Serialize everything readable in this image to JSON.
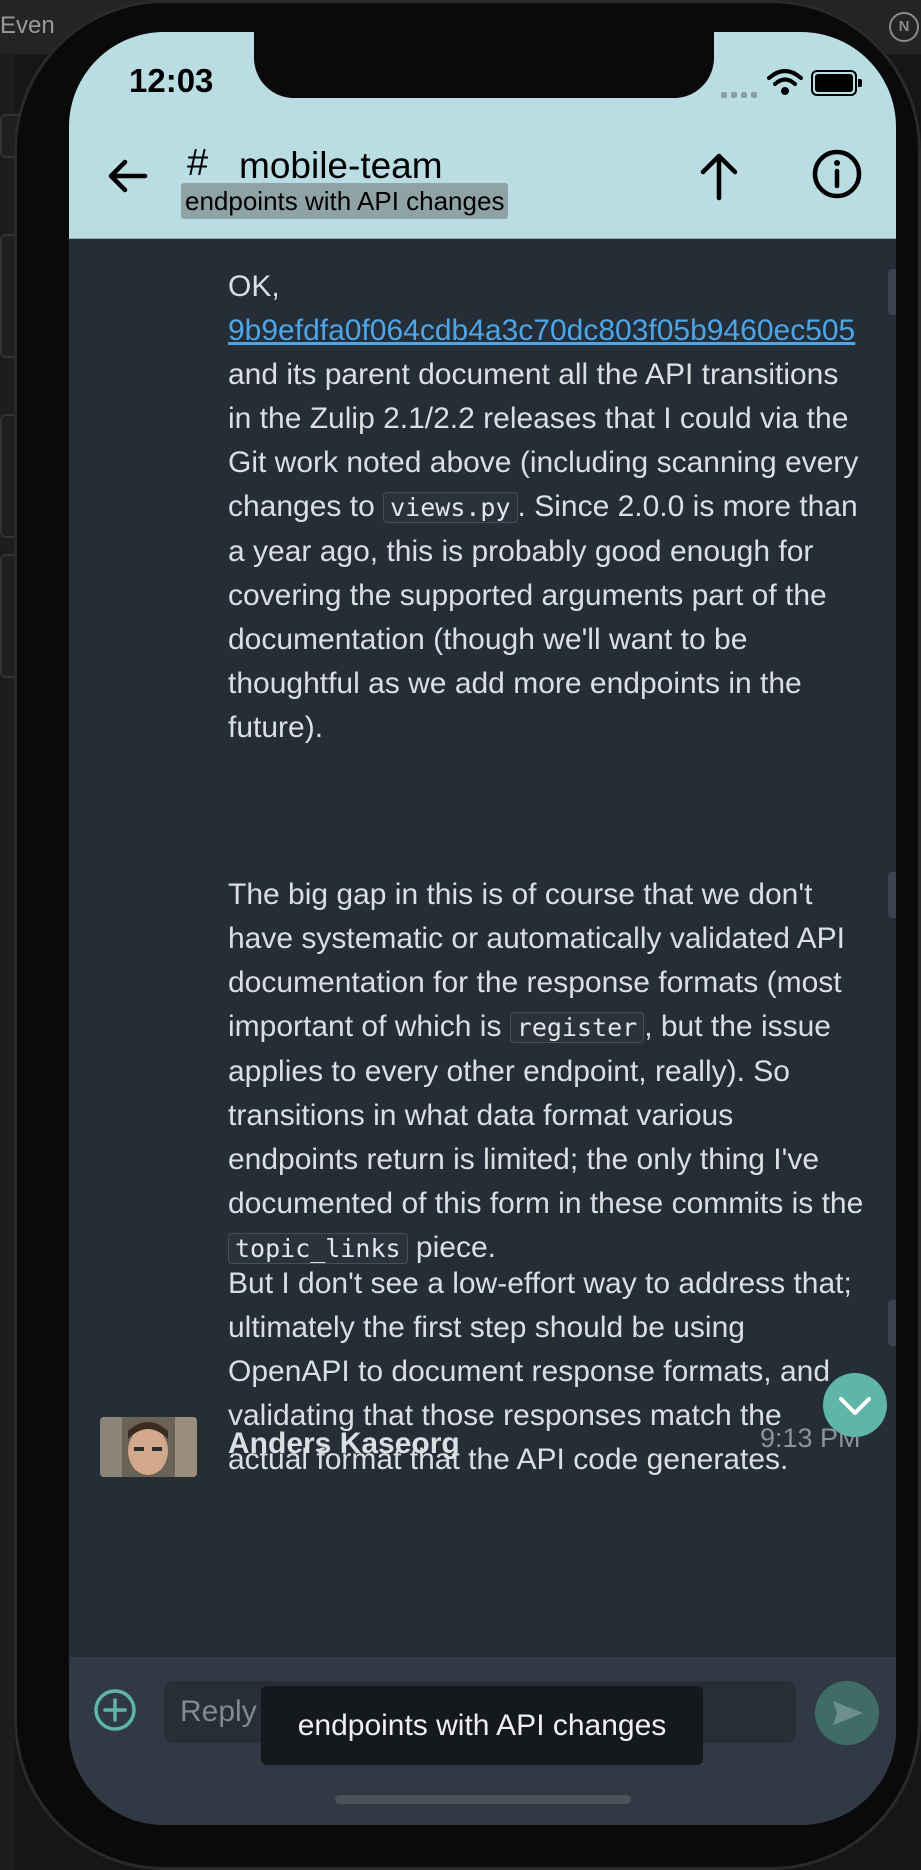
{
  "desktop": {
    "window_label": "Even",
    "right_icon": "N"
  },
  "status_bar": {
    "time": "12:03"
  },
  "header": {
    "back_icon": "arrow-left-icon",
    "stream_icon": "#",
    "stream_name": "mobile-team",
    "topic": "endpoints with API changes",
    "up_icon": "arrow-up-icon",
    "info_icon": "info-icon",
    "background": "#b9dde3"
  },
  "messages": {
    "para1": {
      "lead": "OK,",
      "link": "9b9efdfa0f064cdb4a3c70dc803f05b9460ec505",
      "text1": " and its parent document all the API transitions in the Zulip 2.1/2.2 releases that I could via the Git work noted above (including scanning every changes to ",
      "code1": "views.py",
      "text2": ". Since 2.0.0 is more than a year ago, this is probably good enough for covering the supported arguments part of the documentation (though we'll want to be thoughtful as we add more endpoints in the future)."
    },
    "para2": {
      "text1": "The big gap in this is of course that we don't have systematic or automatically validated API documentation for the response formats (most important of which is ",
      "code1": "register",
      "text2": ", but the issue applies to every other endpoint, really). So transitions in what data format various endpoints return is limited; the only thing I've documented of this form in these commits is the ",
      "code2": "topic_links",
      "text3": " piece."
    },
    "para3": {
      "text": "But I don't see a low-effort way to address that; ultimately the first step should be using OpenAPI to document response formats, and validating that those responses match the actual format that the API code generates."
    },
    "next_message": {
      "sender": "Anders Kaseorg",
      "time": "9:13 PM"
    }
  },
  "compose": {
    "placeholder": "Reply",
    "plus_icon": "plus-circle-icon",
    "send_icon": "send-icon"
  },
  "tooltip": {
    "text": "endpoints with API changes"
  },
  "colors": {
    "link": "#4ca6e8",
    "accent": "#5fb6a8",
    "message_bg": "#252d37"
  }
}
